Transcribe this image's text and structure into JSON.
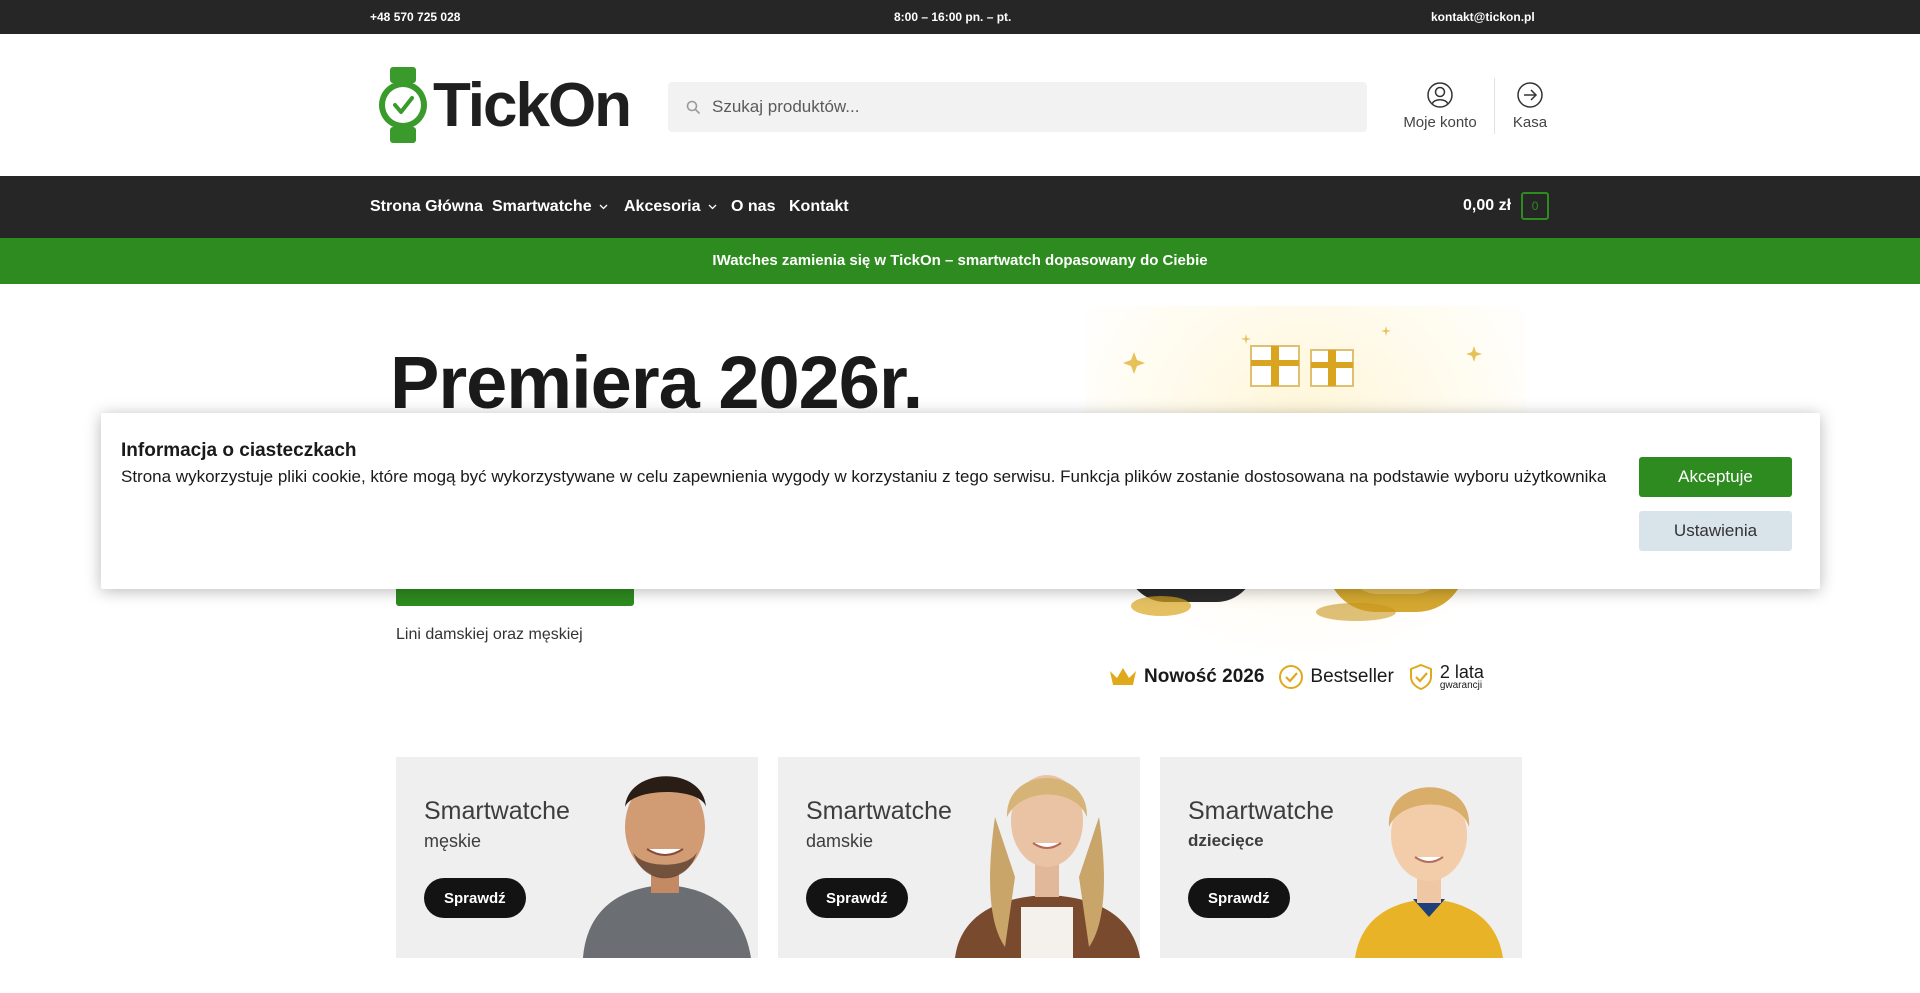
{
  "topbar": {
    "phone": "+48 570 725 028",
    "hours": "8:00 – 16:00 pn. – pt.",
    "email": "kontakt@tickon.pl"
  },
  "header": {
    "logo_text": "TickOn",
    "search_placeholder": "Szukaj produktów...",
    "account_label": "Moje konto",
    "checkout_label": "Kasa"
  },
  "nav": {
    "items": [
      {
        "label": "Strona Główna",
        "has_dropdown": false
      },
      {
        "label": "Smartwatche",
        "has_dropdown": true
      },
      {
        "label": "Akcesoria",
        "has_dropdown": true
      },
      {
        "label": "O nas",
        "has_dropdown": false
      },
      {
        "label": "Kontakt",
        "has_dropdown": false
      }
    ],
    "cart_total": "0,00 zł",
    "cart_count": "0"
  },
  "promo": {
    "text": "IWatches zamienia się w TickOn – smartwatch dopasowany do Ciebie"
  },
  "hero": {
    "title": "Premiera 2026r.",
    "subtitle": "Lini damskiej oraz męskiej",
    "badges": [
      "Nowość 2026",
      "Bestseller",
      "2 lata",
      "gwarancji"
    ]
  },
  "categories": [
    {
      "title": "Smartwatche",
      "subtitle": "męskie",
      "button": "Sprawdź"
    },
    {
      "title": "Smartwatche",
      "subtitle": "damskie",
      "button": "Sprawdź"
    },
    {
      "title": "Smartwatche",
      "subtitle": "dziecięce",
      "button": "Sprawdź"
    }
  ],
  "cookie": {
    "title": "Informacja o ciasteczkach",
    "text": "Strona wykorzystuje pliki cookie, które mogą być wykorzystywane w celu zapewnienia wygody w korzystaniu z tego serwisu. Funkcja plików zostanie dostosowana na podstawie wyboru użytkownika",
    "accept_label": "Akceptuje",
    "settings_label": "Ustawienia"
  },
  "colors": {
    "brand_green": "#2e8b1f",
    "dark_bar": "#262626",
    "settings_button": "#d9e3ea"
  }
}
